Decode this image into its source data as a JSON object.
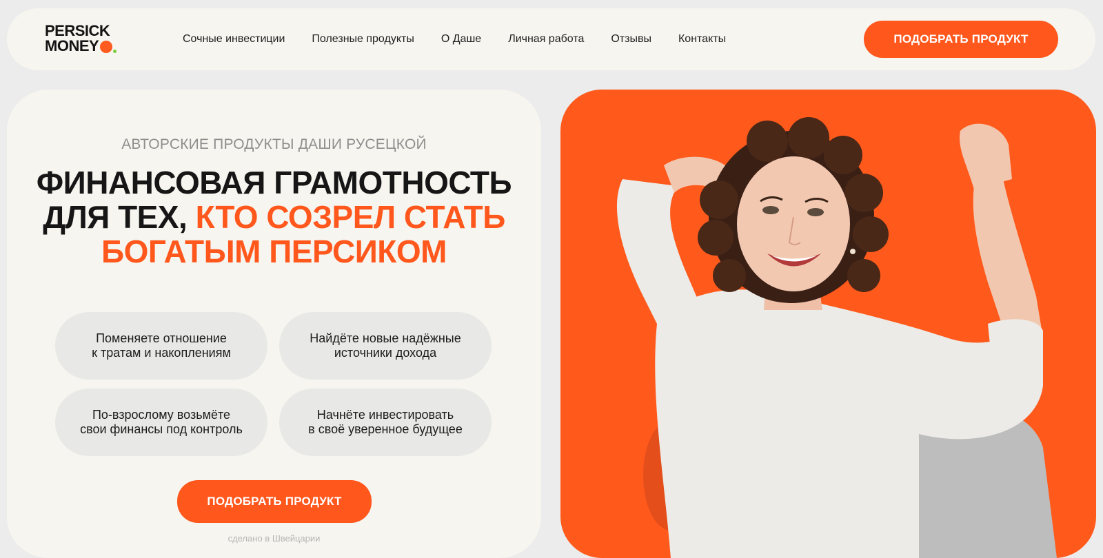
{
  "header": {
    "logo_line1": "PERSICK",
    "logo_line2": "MONEY",
    "nav": [
      "Сочные инвестиции",
      "Полезные продукты",
      "О Даше",
      "Личная работа",
      "Отзывы",
      "Контакты"
    ],
    "cta_label": "ПОДОБРАТЬ ПРОДУКТ"
  },
  "hero": {
    "eyebrow": "АВТОРСКИЕ ПРОДУКТЫ ДАШИ РУСЕЦКОЙ",
    "headline_line1": "ФИНАНСОВАЯ ГРАМОТНОСТЬ",
    "headline_line2_dark": "ДЛЯ ТЕХ,",
    "headline_line2_accent": "КТО СОЗРЕЛ СТАТЬ",
    "headline_line3": "БОГАТЫМ ПЕРСИКОМ",
    "benefits": [
      {
        "line1": "Поменяете отношение",
        "line2": "к тратам и накоплениям"
      },
      {
        "line1": "Найдёте новые надёжные",
        "line2": "источники дохода"
      },
      {
        "line1": "По-взрослому возьмёте",
        "line2": "свои финансы под контроль"
      },
      {
        "line1": "Начнёте инвестировать",
        "line2": "в своё уверенное будущее"
      }
    ],
    "cta_label": "ПОДОБРАТЬ ПРОДУКТ",
    "footnote": "сделано в Швейцарии"
  },
  "colors": {
    "accent": "#ff571c",
    "background": "#ececec",
    "card": "#f6f5ef",
    "pill": "#e8e8e6"
  }
}
